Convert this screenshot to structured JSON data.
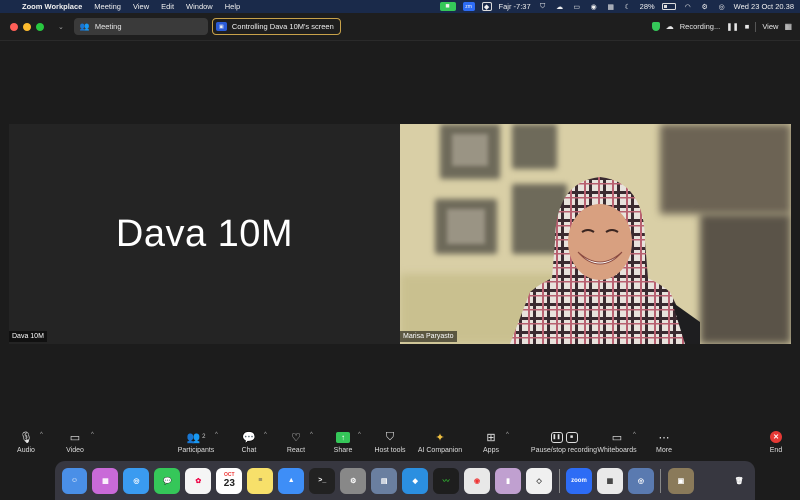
{
  "menubar": {
    "app_name": "Zoom Workplace",
    "menus": [
      "Meeting",
      "View",
      "Edit",
      "Window",
      "Help"
    ],
    "prayer": "Fajr -7:37",
    "battery": "28%",
    "datetime": "Wed 23 Oct  20.38"
  },
  "titlebar": {
    "meeting_tab": "Meeting",
    "control_pill": "Controlling Dava 10M's screen",
    "recording": "Recording...",
    "view": "View"
  },
  "left_tile": {
    "big_name": "Dava 10M",
    "label": "Dava 10M"
  },
  "right_tile": {
    "label": "Marisa Paryasto"
  },
  "toolbar": {
    "audio": "Audio",
    "video": "Video",
    "participants": "Participants",
    "participants_count": "2",
    "chat": "Chat",
    "react": "React",
    "share": "Share",
    "host_tools": "Host tools",
    "ai_companion": "AI Companion",
    "apps": "Apps",
    "pause_stop": "Pause/stop recording",
    "whiteboards": "Whiteboards",
    "more": "More",
    "end": "End"
  },
  "dock": {
    "calendar_month": "OCT",
    "calendar_day": "23",
    "zoom_label": "zoom"
  },
  "colors": {
    "accent_green": "#35c759",
    "end_red": "#e53935",
    "control_border": "#c8a24a"
  }
}
